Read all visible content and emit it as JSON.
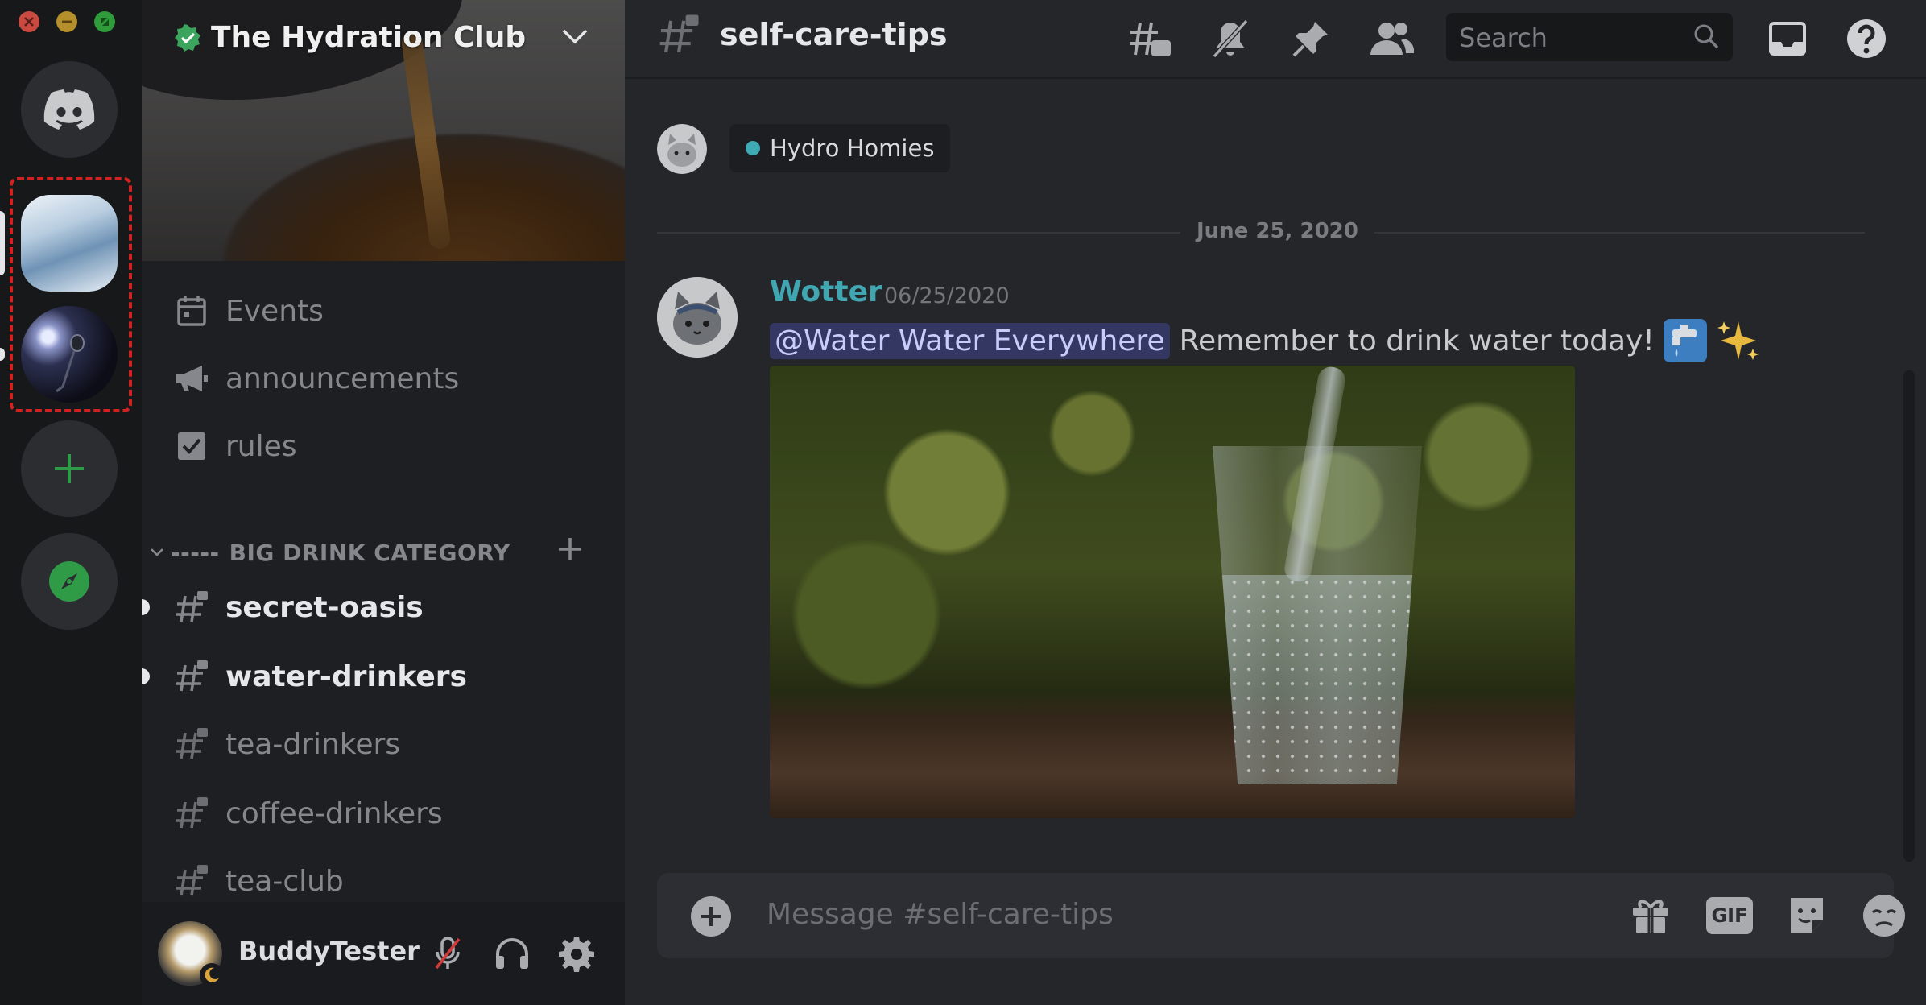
{
  "server": {
    "name": "The Hydration Club"
  },
  "sidebar": {
    "channels_top": [
      {
        "label": "Events",
        "icon": "calendar-icon"
      },
      {
        "label": "announcements",
        "icon": "megaphone-icon"
      },
      {
        "label": "rules",
        "icon": "checkbox-icon"
      }
    ],
    "category": {
      "prefix": "-----",
      "name": "BIG DRINK CATEGORY"
    },
    "channels": [
      {
        "label": "secret-oasis",
        "unread": true
      },
      {
        "label": "water-drinkers",
        "unread": true
      },
      {
        "label": "tea-drinkers",
        "unread": false
      },
      {
        "label": "coffee-drinkers",
        "unread": false
      },
      {
        "label": "tea-club",
        "unread": false
      }
    ]
  },
  "user": {
    "name": "BuddyTester"
  },
  "header": {
    "channel": "self-care-tips",
    "search_placeholder": "Search"
  },
  "feed": {
    "role_chip": "Hydro Homies",
    "date_divider": "June 25, 2020",
    "message": {
      "author": "Wotter",
      "timestamp": "06/25/2020",
      "mention": "@Water Water Everywhere",
      "text": "Remember to drink water today!"
    }
  },
  "composer": {
    "placeholder": "Message #self-care-tips",
    "gif_label": "GIF"
  },
  "colors": {
    "accent_teal": "#40a6b1",
    "mention_bg": "#5865f2",
    "selection_border": "#d32020",
    "online_green": "#3ba55d"
  }
}
